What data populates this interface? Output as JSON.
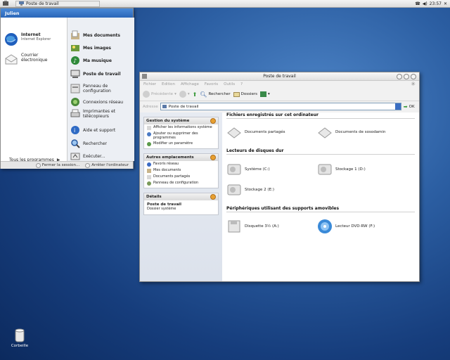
{
  "panel": {
    "task_label": "Poste de travail",
    "clock": "23:57"
  },
  "start_menu": {
    "user": "Julien",
    "pinned": [
      {
        "title": "Internet",
        "subtitle": "Internet Explorer"
      },
      {
        "title": "Courrier électronique",
        "subtitle": ""
      }
    ],
    "all_programs": "Tous les programmes",
    "right_items": [
      "Mes documents",
      "Mes images",
      "Ma musique",
      "Poste de travail",
      "Panneau de configuration",
      "Connexions réseau",
      "Imprimantes et télécopieurs",
      "Aide et support",
      "Rechercher",
      "Exécuter..."
    ],
    "logoff": "Fermer la session...",
    "shutdown": "Arrêter l'ordinateur"
  },
  "window": {
    "title": "Poste de travail",
    "menu": [
      "Fichier",
      "Edition",
      "Affichage",
      "Favoris",
      "Outils",
      "?"
    ],
    "toolbar": {
      "back": "Précédente",
      "search": "Rechercher",
      "folders": "Dossiers"
    },
    "address_label": "Adresse",
    "address_value": "Poste de travail",
    "go": "OK"
  },
  "tasks": {
    "system": {
      "title": "Gestion du système",
      "items": [
        "Afficher les informations système",
        "Ajouter ou supprimer des programmes",
        "Modifier un paramètre"
      ]
    },
    "places": {
      "title": "Autres emplacements",
      "items": [
        "Favoris réseau",
        "Mes documents",
        "Documents partagés",
        "Panneau de configuration"
      ]
    },
    "details": {
      "title": "Détails",
      "name": "Poste de travail",
      "desc": "Dossier système"
    }
  },
  "content": {
    "sections": [
      {
        "title": "Fichiers enregistrés sur cet ordinateur",
        "items": [
          "Documents partagés",
          "Documents de sosodamin"
        ]
      },
      {
        "title": "Lecteurs de disques dur",
        "items": [
          "Système (C:)",
          "Stockage 1 (D:)",
          "Stockage 2 (E:)"
        ]
      },
      {
        "title": "Périphériques utilisant des supports amovibles",
        "items": [
          "Disquette 3½ (A:)",
          "Lecteur DVD-RW (F:)"
        ]
      }
    ]
  },
  "desktop": {
    "trash": "Corbeille"
  },
  "colors": {
    "desktop": "#2c5fa3",
    "start_header": "#2a66b8",
    "panel_chevron": "#e8a030"
  }
}
